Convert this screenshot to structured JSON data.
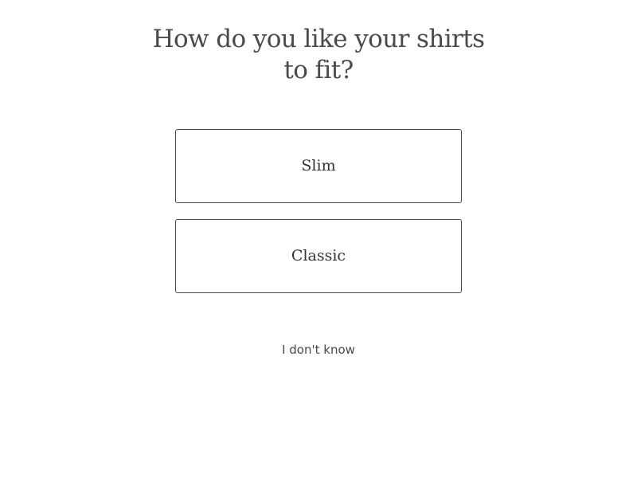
{
  "quiz": {
    "question_line1": "How do you like your shirts",
    "question_line2": "to fit?",
    "options": [
      {
        "label": "Slim"
      },
      {
        "label": "Classic"
      }
    ],
    "skip_label": "I don't know"
  }
}
